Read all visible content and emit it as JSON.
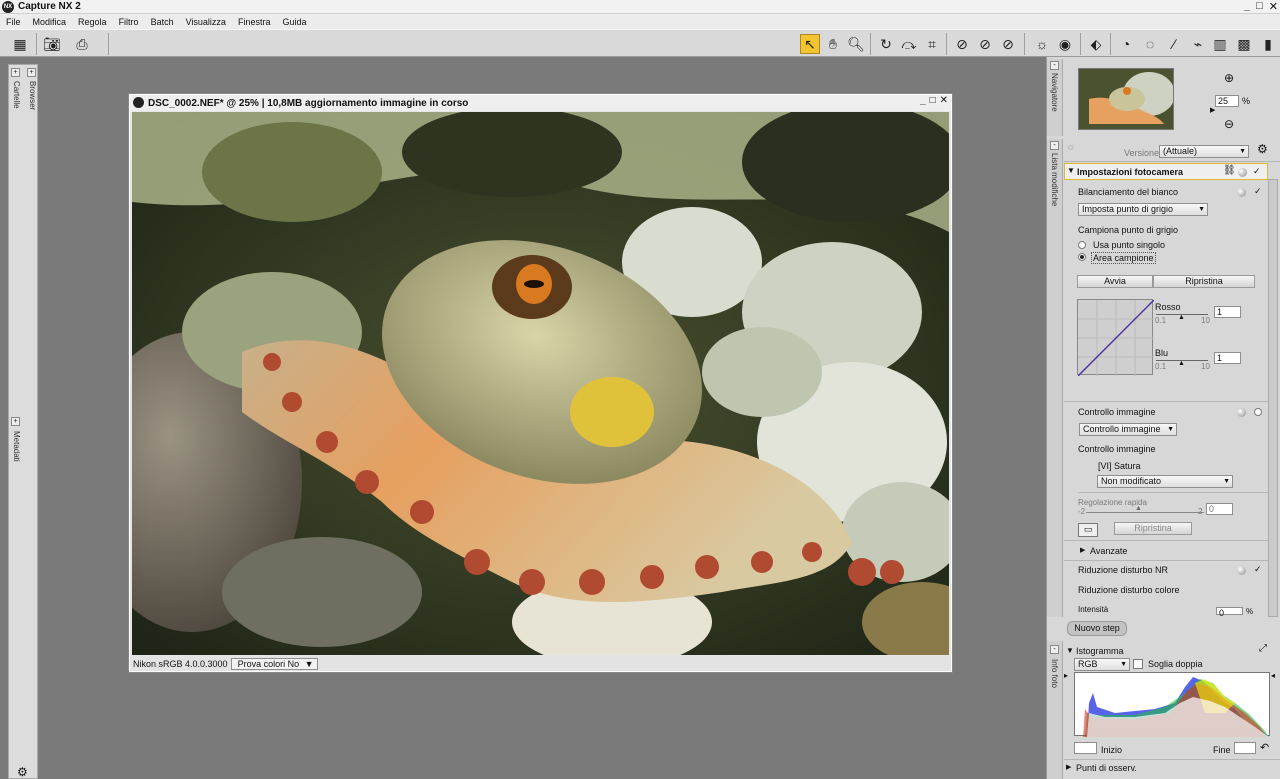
{
  "app": {
    "title": "Capture NX 2",
    "logo_text": "NX",
    "window_buttons": [
      "_",
      "□",
      "✕"
    ]
  },
  "menu": [
    "File",
    "Modifica",
    "Regola",
    "Filtro",
    "Batch",
    "Visualizza",
    "Finestra",
    "Guida"
  ],
  "left_rail": {
    "tabs": [
      "Cartelle",
      "Browser",
      "Metadati"
    ]
  },
  "image_window": {
    "title": "DSC_0002.NEF* @ 25% | 10,8MB aggiornamento immagine in corso",
    "profile": "Nikon sRGB 4.0.0.3000",
    "proof_colors": "Prova colori No"
  },
  "navigator": {
    "tab": "Navigatore",
    "zoom_value": "25",
    "zoom_unit": "%"
  },
  "edit_list": {
    "tab": "Lista modifiche",
    "version_label": "Versione",
    "version_value": "(Attuale)",
    "camera_settings_title": "Impostazioni fotocamera",
    "white_balance": {
      "title": "Bilanciamento del bianco",
      "mode": "Imposta punto di grigio",
      "sample_label": "Campiona punto di grigio",
      "option_single": "Usa punto singolo",
      "option_area": "Area campione",
      "start_button": "Avvia",
      "reset_button": "Ripristina",
      "red_label": "Rosso",
      "red_min": "0.1",
      "red_max": "10",
      "red_value": "1",
      "blue_label": "Blu",
      "blue_min": "0.1",
      "blue_max": "10",
      "blue_value": "1"
    },
    "picture_control": {
      "title": "Controllo immagine",
      "dropdown": "Controllo immagine",
      "sub_label": "Controllo immagine",
      "picture_name": "[VI] Satura",
      "preset": "Non modificato",
      "quick_adjust_label": "Regolazione rapida",
      "quick_min": "-2",
      "quick_max": "2",
      "quick_value": "0",
      "reset_button": "Ripristina",
      "advanced": "Avanzate"
    },
    "noise_reduction": {
      "title": "Riduzione disturbo NR",
      "color_noise": "Riduzione disturbo colore",
      "intensity": "Intensità",
      "intensity_value": "0",
      "intensity_unit": "%"
    },
    "new_step_button": "Nuovo step"
  },
  "photo_info": {
    "tab": "Info foto",
    "histogram_title": "Istogramma",
    "channel": "RGB",
    "double_threshold": "Soglia doppia",
    "start_label": "Inizio",
    "end_label": "Fine",
    "watch_points": "Punti di osserv."
  },
  "colors": {
    "accent": "#f3c430",
    "panel_bg": "#d7d7d7",
    "workspace_bg": "#7a7a7a"
  }
}
